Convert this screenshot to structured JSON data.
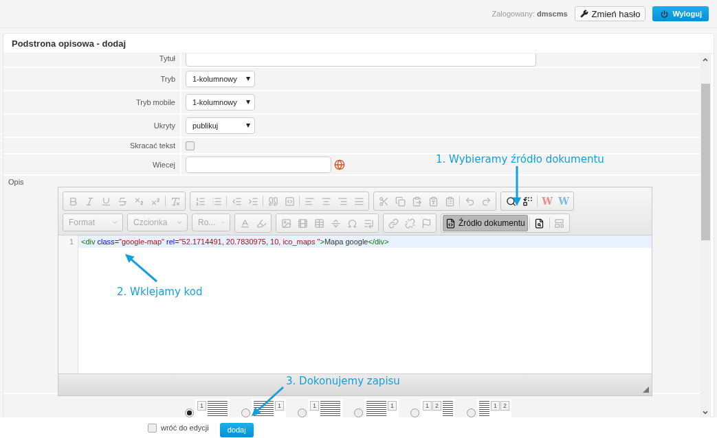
{
  "header": {
    "logged_in_label": "Zalogowany:",
    "username": "dmscms",
    "change_password": "Zmień hasło",
    "logout": "Wyloguj"
  },
  "panel": {
    "title": "Podstrona opisowa - dodaj"
  },
  "fields": [
    {
      "kind": "text",
      "label": "Tytuł"
    },
    {
      "kind": "select",
      "label": "Tryb",
      "value": "1-kolumnowy"
    },
    {
      "kind": "select",
      "label": "Tryb mobile",
      "value": "1-kolumnowy"
    },
    {
      "kind": "select",
      "label": "Ukryty",
      "value": "publikuj"
    },
    {
      "kind": "checkbox",
      "label": "Skracać tekst",
      "checked": false
    },
    {
      "kind": "link",
      "label": "Wiecej"
    }
  ],
  "editor": {
    "label": "Opis",
    "toolbar": [
      [
        [
          {
            "kind": "bold",
            "disabled": true
          },
          {
            "kind": "italic",
            "disabled": true
          },
          {
            "kind": "underline",
            "disabled": true
          },
          {
            "kind": "strike",
            "disabled": true
          },
          {
            "kind": "subscript",
            "disabled": true
          },
          {
            "kind": "superscript",
            "disabled": true
          },
          {
            "kind": "separator"
          },
          {
            "kind": "removeformat",
            "disabled": true
          }
        ],
        [
          {
            "kind": "numbered",
            "disabled": true
          },
          {
            "kind": "bulleted",
            "disabled": true
          },
          {
            "kind": "separator"
          },
          {
            "kind": "outdent",
            "disabled": true
          },
          {
            "kind": "indent",
            "disabled": true
          },
          {
            "kind": "separator"
          },
          {
            "kind": "blockquote",
            "disabled": true
          },
          {
            "kind": "div",
            "disabled": true
          },
          {
            "kind": "separator"
          },
          {
            "kind": "alignleft",
            "disabled": true
          },
          {
            "kind": "aligncenter",
            "disabled": true
          },
          {
            "kind": "alignright",
            "disabled": true
          },
          {
            "kind": "justify",
            "disabled": true
          }
        ],
        [
          {
            "kind": "cut",
            "disabled": true
          },
          {
            "kind": "copy",
            "disabled": true
          },
          {
            "kind": "paste",
            "disabled": true
          },
          {
            "kind": "pastetext",
            "disabled": true
          },
          {
            "kind": "pasteword",
            "disabled": true
          },
          {
            "kind": "separator"
          },
          {
            "kind": "undo",
            "disabled": true
          },
          {
            "kind": "redo",
            "disabled": true
          }
        ],
        [
          {
            "kind": "find",
            "disabled": false
          },
          {
            "kind": "replace",
            "disabled": false
          },
          {
            "kind": "separator"
          },
          {
            "kind": "scayt",
            "text": "W",
            "disabled": true
          },
          {
            "kind": "wsc",
            "text": "W",
            "disabled": true
          }
        ]
      ],
      [
        [
          {
            "kind": "combo",
            "text": "Format",
            "disabled": true
          }
        ],
        [
          {
            "kind": "combo",
            "text": "Czcionka",
            "disabled": true
          }
        ],
        [
          {
            "kind": "combo",
            "text": "Ro...",
            "disabled": true
          }
        ],
        [
          {
            "kind": "textcolor",
            "disabled": true
          },
          {
            "kind": "bgcolor",
            "disabled": true
          }
        ],
        [
          {
            "kind": "image",
            "disabled": true
          },
          {
            "kind": "flash",
            "disabled": true
          },
          {
            "kind": "table",
            "disabled": true
          },
          {
            "kind": "hr",
            "disabled": true
          },
          {
            "kind": "specialchar",
            "disabled": true
          },
          {
            "kind": "pagebreak",
            "disabled": true
          }
        ],
        [
          {
            "kind": "link",
            "disabled": true
          },
          {
            "kind": "unlink",
            "disabled": true
          },
          {
            "kind": "anchor",
            "disabled": true
          }
        ],
        [
          {
            "kind": "source",
            "text": "Źródło dokumentu",
            "on": true,
            "disabled": false
          },
          {
            "kind": "separator"
          },
          {
            "kind": "preview",
            "disabled": false
          },
          {
            "kind": "separator"
          },
          {
            "kind": "templates",
            "disabled": true
          }
        ]
      ]
    ],
    "lines": [
      {
        "number": "1",
        "tokens": [
          {
            "kind": "tag",
            "text": "<div"
          },
          {
            "kind": "attr",
            "text": " class"
          },
          {
            "kind": "plain",
            "text": "="
          },
          {
            "kind": "string",
            "text": "\"google-map\""
          },
          {
            "kind": "attr",
            "text": " rel"
          },
          {
            "kind": "plain",
            "text": "="
          },
          {
            "kind": "string",
            "text": "\"52.1714491, 20.7830975, 10, ico_maps \""
          },
          {
            "kind": "tag",
            "text": ">"
          },
          {
            "kind": "plain",
            "text": "Mapa google"
          },
          {
            "kind": "tag",
            "text": "</div>"
          }
        ]
      }
    ]
  },
  "layouts": [
    {
      "kind": "boxleft",
      "numbers": [
        "1"
      ],
      "selected": true
    },
    {
      "kind": "boxright",
      "numbers": [
        "1"
      ],
      "selected": false
    },
    {
      "kind": "boxleft",
      "numbers": [
        "1"
      ],
      "selected": false
    },
    {
      "kind": "boxright",
      "numbers": [
        "1"
      ],
      "selected": false
    },
    {
      "kind": "boxleft",
      "numbers": [
        "1",
        "2"
      ],
      "selected": false
    },
    {
      "kind": "boxright",
      "numbers": [
        "1",
        "2"
      ],
      "selected": false
    }
  ],
  "footer": {
    "return_label": "wróć do edycji",
    "return_checked": false,
    "submit": "dodaj"
  },
  "annotations": [
    {
      "kind": "source",
      "text": "1. Wybieramy źródło dokumentu"
    },
    {
      "kind": "paste",
      "text": "2. Wklejamy kod"
    },
    {
      "kind": "save",
      "text": "3. Dokonujemy zapisu"
    }
  ]
}
